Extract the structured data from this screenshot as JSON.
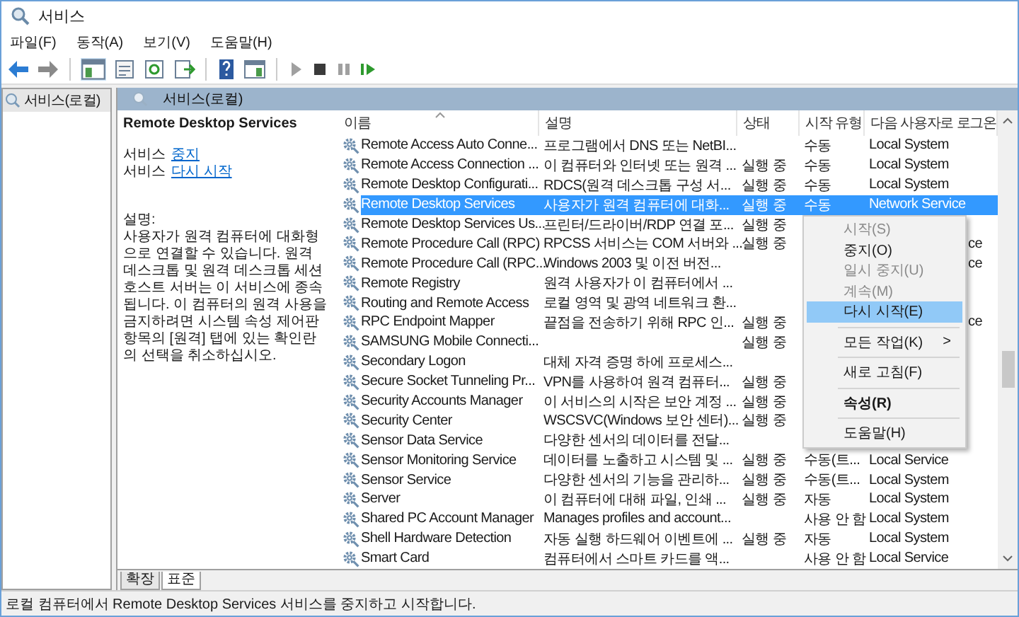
{
  "window": {
    "title": "서비스"
  },
  "menu": [
    "파일(F)",
    "동작(A)",
    "보기(V)",
    "도움말(H)"
  ],
  "tree": {
    "items": [
      {
        "label": "서비스(로컬)",
        "selected": true
      }
    ]
  },
  "panel_header": "서비스(로컬)",
  "detail": {
    "title": "Remote Desktop Services",
    "actions": [
      {
        "prefix": "서비스",
        "link": "중지"
      },
      {
        "prefix": "서비스",
        "link": "다시 시작"
      }
    ],
    "description_label": "설명:",
    "description": "사용자가 원격 컴퓨터에 대화형으로 연결할 수 있습니다. 원격 데스크톱 및 원격 데스크톱 세션 호스트 서버는 이 서비스에 종속됩니다. 이 컴퓨터의 원격 사용을 금지하려면 시스템 속성 제어판 항목의 [원격] 탭에 있는 확인란의 선택을 취소하십시오."
  },
  "table": {
    "columns": [
      "이름",
      "설명",
      "상태",
      "시작 유형",
      "다음 사용자로 로그온"
    ],
    "rows": [
      {
        "name": "Remote Access Auto Conne...",
        "description": "프로그램에서 DNS 또는 NetBI...",
        "startup": "수동",
        "logon": "Local System",
        "selected": false
      },
      {
        "name": "Remote Access Connection ...",
        "description": "이 컴퓨터와 인터넷 또는 원격 ...",
        "status": "실행 중",
        "startup": "수동",
        "logon": "Local System",
        "selected": false
      },
      {
        "name": "Remote Desktop Configurati...",
        "description": "RDCS(원격 데스크톱 구성 서...",
        "status": "실행 중",
        "startup": "수동",
        "logon": "Local System",
        "selected": false
      },
      {
        "name": "Remote Desktop Services",
        "description": "사용자가 원격 컴퓨터에 대화...",
        "status": "실행 중",
        "startup": "수동",
        "logon": "Network Service",
        "selected": true
      },
      {
        "name": "Remote Desktop Services Us...",
        "description": "프린터/드라이버/RDP 연결 포...",
        "status": "실행 중",
        "selected": false
      },
      {
        "name": "Remote Procedure Call (RPC)",
        "description": "RPCSS 서비스는 COM 서버와 ...",
        "status": "실행 중",
        "logon_partial": "ce",
        "selected": false
      },
      {
        "name": "Remote Procedure Call (RPC...",
        "description": "Windows 2003 및 이전 버전...",
        "logon_partial": "ce",
        "selected": false
      },
      {
        "name": "Remote Registry",
        "description": "원격 사용자가 이 컴퓨터에서 ...",
        "selected": false
      },
      {
        "name": "Routing and Remote Access",
        "description": "로컬 영역 및 광역 네트워크 환...",
        "selected": false
      },
      {
        "name": "RPC Endpoint Mapper",
        "description": "끝점을 전송하기 위해 RPC 인...",
        "status": "실행 중",
        "logon_partial": "ce",
        "selected": false
      },
      {
        "name": "SAMSUNG Mobile Connecti...",
        "status": "실행 중",
        "selected": false
      },
      {
        "name": "Secondary Logon",
        "description": "대체 자격 증명 하에 프로세스...",
        "selected": false
      },
      {
        "name": "Secure Socket Tunneling Pr...",
        "description": "VPN를 사용하여 원격 컴퓨터...",
        "status": "실행 중",
        "selected": false
      },
      {
        "name": "Security Accounts Manager",
        "description": "이 서비스의 시작은 보안 계정 ...",
        "status": "실행 중",
        "selected": false
      },
      {
        "name": "Security Center",
        "description": "WSCSVC(Windows 보안 센터)...",
        "status": "실행 중",
        "selected": false
      },
      {
        "name": "Sensor Data Service",
        "description": "다양한 센서의 데이터를 전달...",
        "selected": false
      },
      {
        "name": "Sensor Monitoring Service",
        "description": "데이터를 노출하고 시스템 및 ...",
        "status": "실행 중",
        "startup": "수동(트...",
        "logon": "Local Service",
        "selected": false
      },
      {
        "name": "Sensor Service",
        "description": "다양한 센서의 기능을 관리하...",
        "status": "실행 중",
        "startup": "수동(트...",
        "logon": "Local System",
        "selected": false
      },
      {
        "name": "Server",
        "description": "이 컴퓨터에 대해 파일, 인쇄 ...",
        "status": "실행 중",
        "startup": "자동",
        "logon": "Local System",
        "selected": false
      },
      {
        "name": "Shared PC Account Manager",
        "description": "Manages profiles and account...",
        "startup": "사용 안 함",
        "logon": "Local System",
        "selected": false
      },
      {
        "name": "Shell Hardware Detection",
        "description": "자동 실행 하드웨어 이벤트에 ...",
        "status": "실행 중",
        "startup": "자동",
        "logon": "Local System",
        "selected": false
      },
      {
        "name": "Smart Card",
        "description": "컴퓨터에서 스마트 카드를 액...",
        "startup": "사용 안 함",
        "logon": "Local Service",
        "selected": false
      }
    ]
  },
  "context_menu": [
    {
      "kind": "item",
      "label": "시작(S)",
      "disabled": true,
      "selected": false
    },
    {
      "kind": "item",
      "label": "중지(O)",
      "disabled": false,
      "selected": false
    },
    {
      "kind": "item",
      "label": "일시 중지(U)",
      "disabled": true,
      "selected": false
    },
    {
      "kind": "item",
      "label": "계속(M)",
      "disabled": true,
      "selected": false
    },
    {
      "kind": "item",
      "label": "다시 시작(E)",
      "disabled": false,
      "selected": true
    },
    {
      "kind": "separator"
    },
    {
      "kind": "submenu",
      "label": "모든 작업(K)",
      "arrow": ">",
      "disabled": false,
      "selected": false
    },
    {
      "kind": "separator"
    },
    {
      "kind": "item",
      "label": "새로 고침(F)",
      "disabled": false,
      "selected": false
    },
    {
      "kind": "separator"
    },
    {
      "kind": "bold",
      "label": "속성(R)",
      "disabled": false,
      "selected": false
    },
    {
      "kind": "separator"
    },
    {
      "kind": "item",
      "label": "도움말(H)",
      "disabled": false,
      "selected": false
    }
  ],
  "view_tabs": [
    {
      "label": "확장",
      "selected": false
    },
    {
      "label": "표준",
      "selected": true
    }
  ],
  "status_bar": "로컬 컴퓨터에서 Remote Desktop Services 서비스를 중지하고 시작합니다."
}
